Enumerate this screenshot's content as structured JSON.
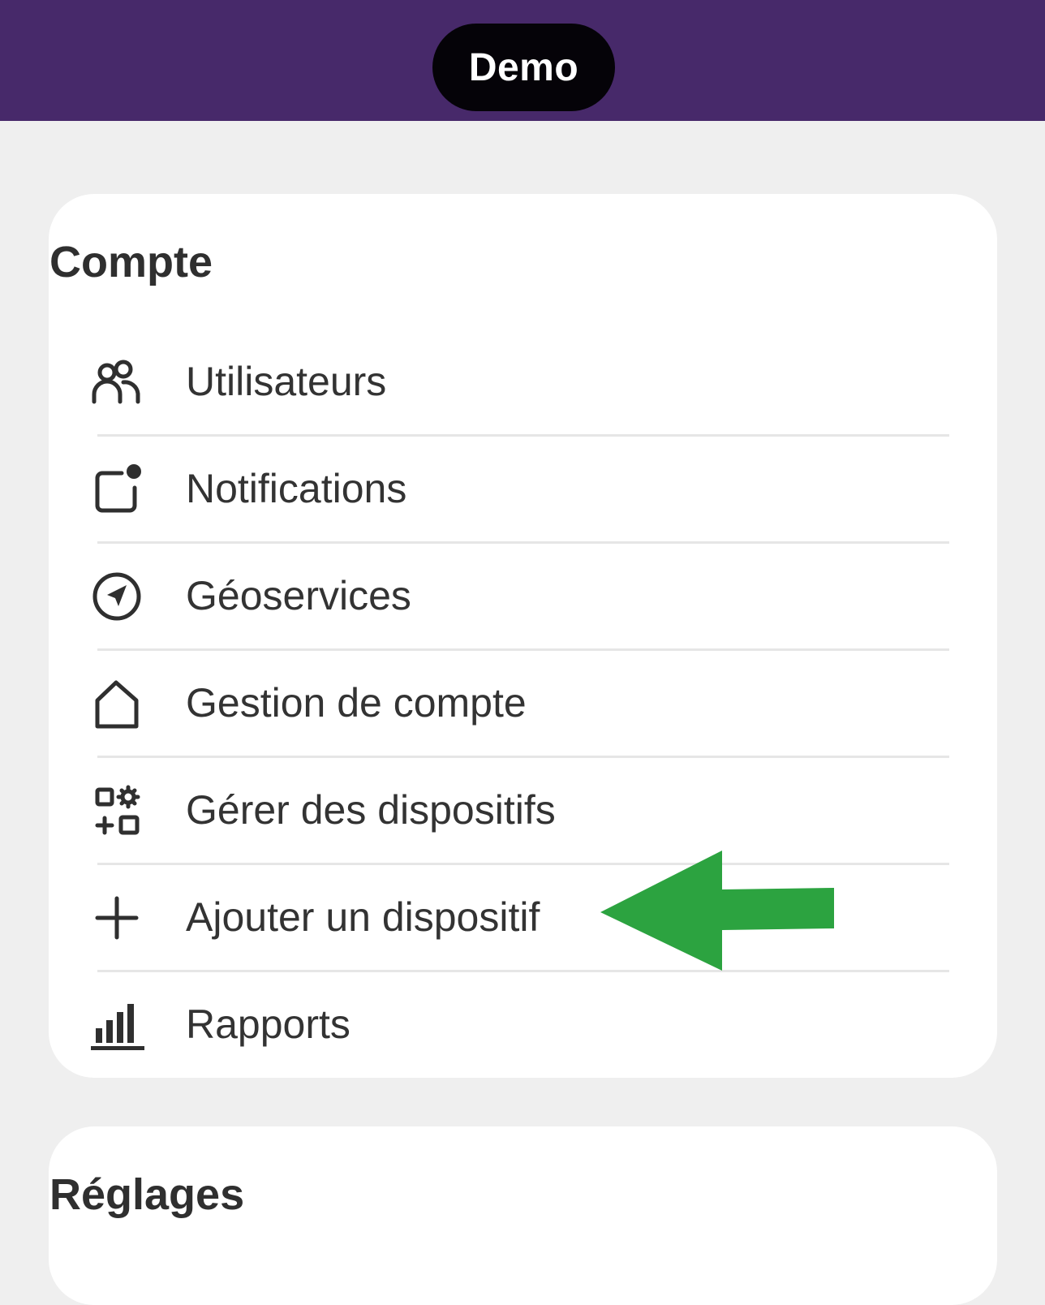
{
  "header": {
    "title": "Demo",
    "background_color": "#47296a"
  },
  "account_section": {
    "title": "Compte",
    "items": [
      {
        "label": "Utilisateurs",
        "icon": "users-icon"
      },
      {
        "label": "Notifications",
        "icon": "notification-badge-icon"
      },
      {
        "label": "Géoservices",
        "icon": "location-arrow-icon"
      },
      {
        "label": "Gestion de compte",
        "icon": "house-icon"
      },
      {
        "label": "Gérer des dispositifs",
        "icon": "device-manage-icon"
      },
      {
        "label": "Ajouter un dispositif",
        "icon": "plus-icon"
      },
      {
        "label": "Rapports",
        "icon": "bar-chart-icon"
      }
    ]
  },
  "settings_section": {
    "title": "Réglages"
  },
  "annotation": {
    "icon": "arrow-left-icon",
    "color": "#2ca340"
  }
}
